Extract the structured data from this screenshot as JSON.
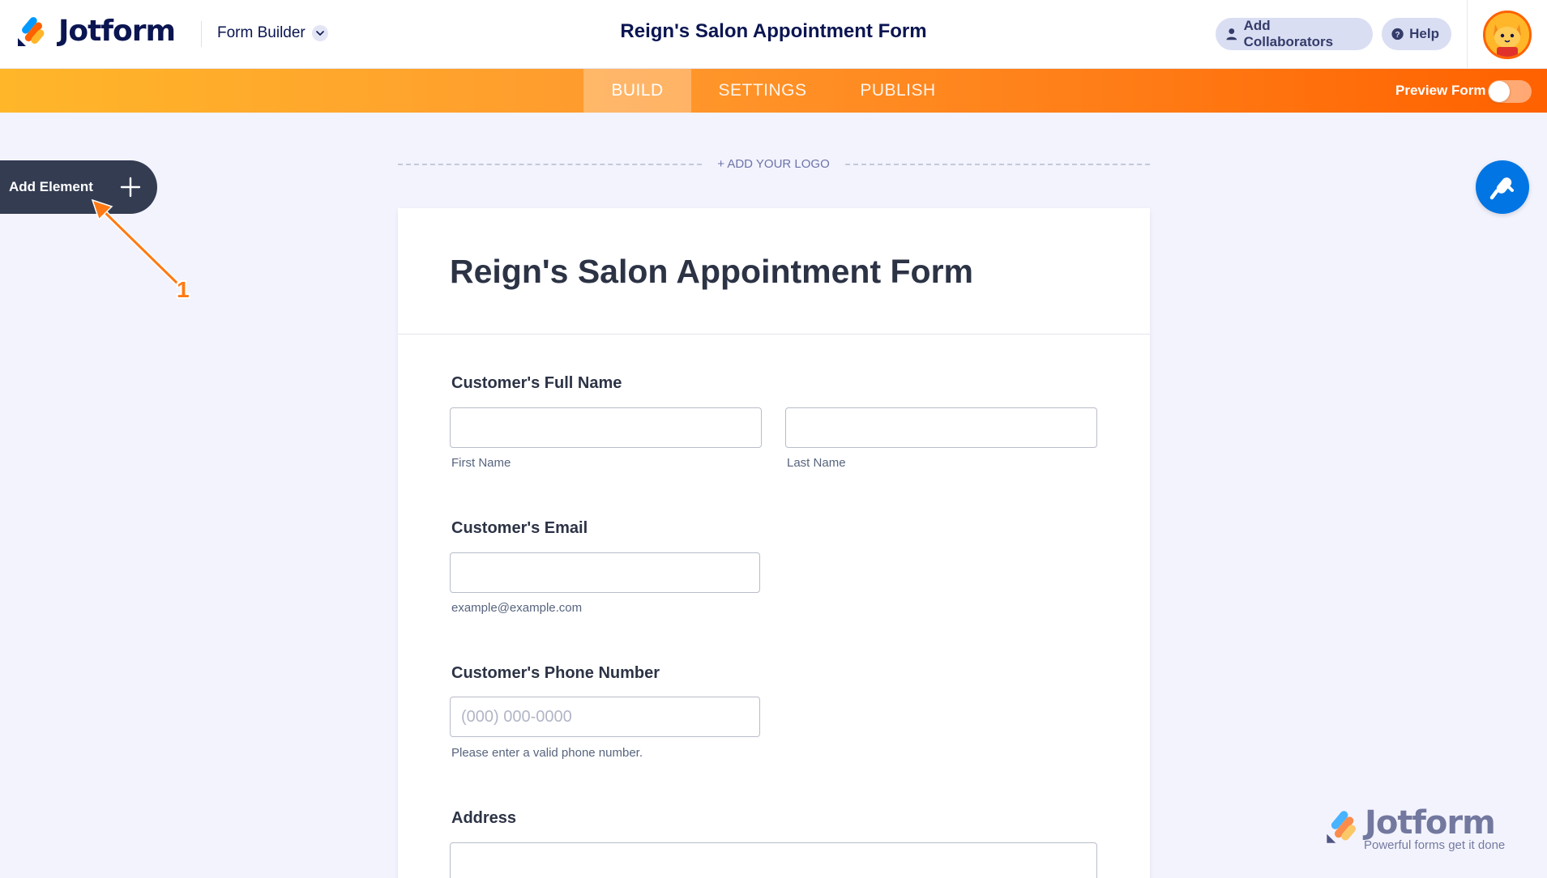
{
  "header": {
    "brand": "Jotform",
    "mode_label": "Form Builder",
    "title": "Reign's Salon Appointment Form",
    "collaborators_label": "Add Collaborators",
    "help_label": "Help"
  },
  "nav": {
    "tabs": [
      {
        "label": "BUILD",
        "active": true
      },
      {
        "label": "SETTINGS",
        "active": false
      },
      {
        "label": "PUBLISH",
        "active": false
      }
    ],
    "preview_label": "Preview Form",
    "preview_on": false
  },
  "sidebar": {
    "add_element_label": "Add Element"
  },
  "annotation": {
    "number": "1"
  },
  "logo_placeholder": "+ ADD YOUR LOGO",
  "form": {
    "title": "Reign's Salon Appointment Form",
    "fields": {
      "full_name": {
        "label": "Customer's Full Name",
        "first_sublabel": "First Name",
        "last_sublabel": "Last Name",
        "first_value": "",
        "last_value": ""
      },
      "email": {
        "label": "Customer's Email",
        "value": "",
        "sublabel": "example@example.com"
      },
      "phone": {
        "label": "Customer's Phone Number",
        "value": "",
        "placeholder": "(000) 000-0000",
        "sublabel": "Please enter a valid phone number."
      },
      "address": {
        "label": "Address",
        "value": ""
      }
    }
  },
  "watermark": {
    "brand": "Jotform",
    "tagline": "Powerful forms get it done"
  },
  "colors": {
    "brand_navy": "#0a1551",
    "orange": "#ff6100",
    "yellow": "#ffb629",
    "blue": "#0075e3",
    "dark_panel": "#343c52"
  },
  "icons": {
    "logo": "jotform-logo-icon",
    "chevron": "chevron-down-icon",
    "user": "user-icon",
    "help": "question-circle-icon",
    "plus": "plus-icon",
    "designer": "paint-roller-icon"
  }
}
